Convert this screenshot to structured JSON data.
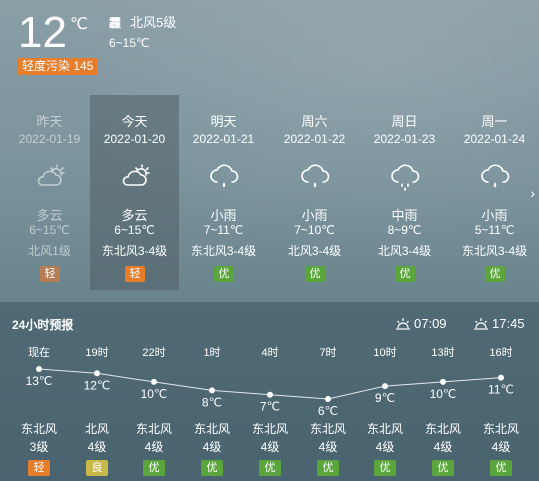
{
  "current": {
    "temp": "12",
    "unit": "℃",
    "icon": "haze-icon",
    "icon_char": "霾",
    "wind": "北风5级",
    "range": "6~15℃",
    "aqi": "轻度污染 145"
  },
  "days": [
    {
      "name": "昨天",
      "date": "2022-01-19",
      "icon": "cloudy-icon",
      "cond": "多云",
      "temp": "6~15℃",
      "wind": "北风1级",
      "aqi": "轻",
      "aqi_color": "#b57c55"
    },
    {
      "name": "今天",
      "date": "2022-01-20",
      "icon": "cloudy-icon",
      "cond": "多云",
      "temp": "6~15℃",
      "wind": "东北风3-4级",
      "aqi": "轻",
      "aqi_color": "#e67d2c"
    },
    {
      "name": "明天",
      "date": "2022-01-21",
      "icon": "light-rain-icon",
      "cond": "小雨",
      "temp": "7~11℃",
      "wind": "东北风3-4级",
      "aqi": "优",
      "aqi_color": "#5aa63c"
    },
    {
      "name": "周六",
      "date": "2022-01-22",
      "icon": "light-rain-icon",
      "cond": "小雨",
      "temp": "7~10℃",
      "wind": "北风3-4级",
      "aqi": "优",
      "aqi_color": "#5aa63c"
    },
    {
      "name": "周日",
      "date": "2022-01-23",
      "icon": "moderate-rain-icon",
      "cond": "中雨",
      "temp": "8~9℃",
      "wind": "北风3-4级",
      "aqi": "优",
      "aqi_color": "#5aa63c"
    },
    {
      "name": "周一",
      "date": "2022-01-24",
      "icon": "light-rain-icon",
      "cond": "小雨",
      "temp": "5~11℃",
      "wind": "东北风3-4级",
      "aqi": "优",
      "aqi_color": "#5aa63c"
    }
  ],
  "hourly": {
    "title": "24小时预报",
    "sunrise": "07:09",
    "sunset": "17:45",
    "items": [
      {
        "time": "现在",
        "temp": 13,
        "temp_label": "13℃",
        "wind": "东北风",
        "level": "3级",
        "aqi": "轻",
        "aqi_color": "#e67d2c"
      },
      {
        "time": "19时",
        "temp": 12,
        "temp_label": "12℃",
        "wind": "北风",
        "level": "4级",
        "aqi": "良",
        "aqi_color": "#c9b84a"
      },
      {
        "time": "22时",
        "temp": 10,
        "temp_label": "10℃",
        "wind": "东北风",
        "level": "4级",
        "aqi": "优",
        "aqi_color": "#5aa63c"
      },
      {
        "time": "1时",
        "temp": 8,
        "temp_label": "8℃",
        "wind": "东北风",
        "level": "4级",
        "aqi": "优",
        "aqi_color": "#5aa63c"
      },
      {
        "time": "4时",
        "temp": 7,
        "temp_label": "7℃",
        "wind": "东北风",
        "level": "4级",
        "aqi": "优",
        "aqi_color": "#5aa63c"
      },
      {
        "time": "7时",
        "temp": 6,
        "temp_label": "6℃",
        "wind": "东北风",
        "level": "4级",
        "aqi": "优",
        "aqi_color": "#5aa63c"
      },
      {
        "time": "10时",
        "temp": 9,
        "temp_label": "9℃",
        "wind": "东北风",
        "level": "4级",
        "aqi": "优",
        "aqi_color": "#5aa63c"
      },
      {
        "time": "13时",
        "temp": 10,
        "temp_label": "10℃",
        "wind": "东北风",
        "level": "4级",
        "aqi": "优",
        "aqi_color": "#5aa63c"
      },
      {
        "time": "16时",
        "temp": 11,
        "temp_label": "11℃",
        "wind": "东北风",
        "level": "4级",
        "aqi": "优",
        "aqi_color": "#5aa63c"
      }
    ]
  }
}
